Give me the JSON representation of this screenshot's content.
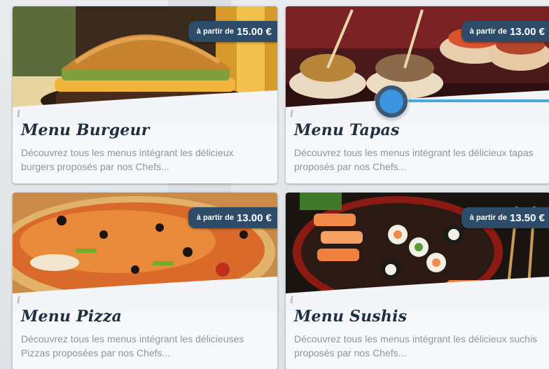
{
  "cards": [
    {
      "title": "Menu Burgeur",
      "description": "Découvrez tous les menus intégrant les délicieux burgers proposés par nos Chefs...",
      "price_prefix": "à partir de",
      "price": "15.00 €",
      "image": "burger-photo",
      "info_icon": "i"
    },
    {
      "title": "Menu Tapas",
      "description": "Découvrez tous les menus intégrant les délicieux tapas proposés par nos Chefs...",
      "price_prefix": "à partir de",
      "price": "13.00 €",
      "image": "tapas-photo",
      "info_icon": "i"
    },
    {
      "title": "Menu Pizza",
      "description": "Découvrez tous les menus intégrant les délicieuses Pizzas proposées par nos Chefs...",
      "price_prefix": "à partir de",
      "price": "13.00 €",
      "image": "pizza-photo",
      "info_icon": "i"
    },
    {
      "title": "Menu Sushis",
      "description": "Découvrez tous les menus intégrant les délicieux suchis proposés par nos Chefs...",
      "price_prefix": "à partir de",
      "price": "13.50 €",
      "image": "sushi-photo",
      "info_icon": "i"
    }
  ],
  "colors": {
    "badge": "#2d4c69",
    "title": "#1f3042",
    "description": "#8f959e",
    "slider_accent": "#3b94dd"
  },
  "slider": {
    "position_fraction": 0.0
  }
}
